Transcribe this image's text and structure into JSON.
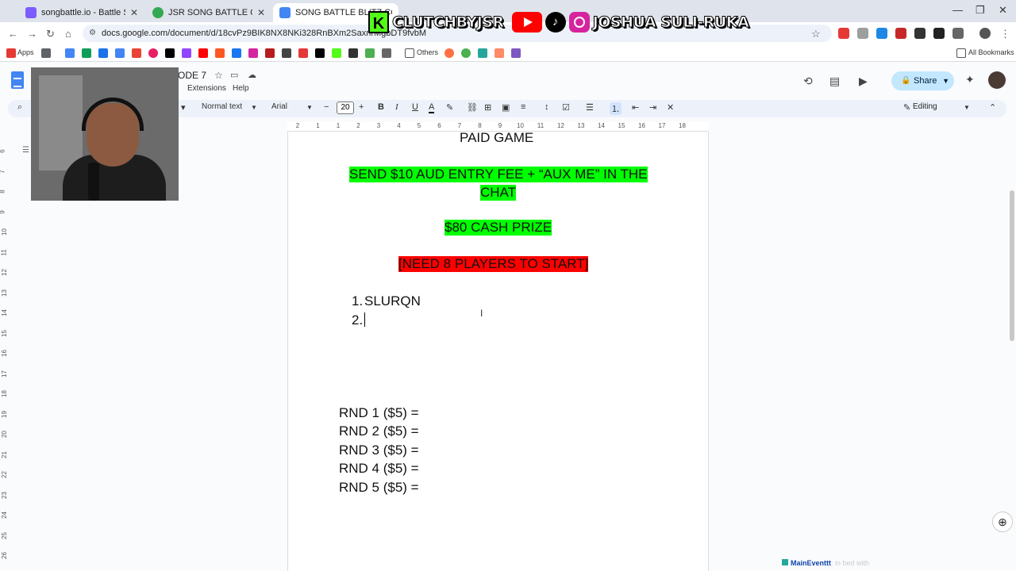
{
  "browser": {
    "tabs": [
      {
        "title": "songbattle.io - Battle Songs ag",
        "color": "#7c5cff"
      },
      {
        "title": "JSR SONG BATTLE CATEGORY",
        "color": "#34a853"
      },
      {
        "title": "SONG BATTLE BLITZ COMP",
        "color": "#4285f4"
      }
    ],
    "new_tab": "+",
    "url": "docs.google.com/document/d/18cvPz9BIK8NX8NKi328RnBXm2SaxnrMgbDT9fvbM",
    "window_controls": {
      "minimize": "—",
      "maximize": "❐",
      "close": "✕"
    }
  },
  "bookmarks": {
    "apps_label": "Apps",
    "others_label": "Others",
    "all_bookmarks_label": "All Bookmarks"
  },
  "overlay": {
    "kick_letter": "K",
    "kick_name": "CLUTCHBYJSR",
    "social_name": "JOSHUA SULI-RUKA"
  },
  "docs": {
    "title": "ODE 7",
    "menus": {
      "extensions": "Extensions",
      "help": "Help"
    },
    "share_label": "Share",
    "toolbar": {
      "style": "Normal text",
      "font": "Arial",
      "font_size": "20",
      "bold": "B",
      "italic": "I",
      "underline": "U",
      "text_color": "A",
      "mode": "Editing"
    },
    "ruler_numbers": [
      "2",
      "1",
      "1",
      "2",
      "3",
      "4",
      "5",
      "6",
      "7",
      "8",
      "9",
      "10",
      "11",
      "12",
      "13",
      "14",
      "15",
      "16",
      "17",
      "18"
    ],
    "vruler_numbers": [
      "6",
      "7",
      "8",
      "9",
      "10",
      "11",
      "12",
      "13",
      "14",
      "15",
      "16",
      "17",
      "18",
      "19",
      "20",
      "21",
      "22",
      "23",
      "24",
      "25",
      "26"
    ]
  },
  "document": {
    "heading": "PAID GAME",
    "entry_fee_line1": "SEND $10 AUD ENTRY FEE + “AUX ME” IN THE",
    "entry_fee_line2": "CHAT",
    "prize": "$80 CASH PRIZE",
    "players_needed": "[NEED 8 PLAYERS TO START]",
    "players": [
      {
        "num": "1.",
        "name": "SLURQN"
      },
      {
        "num": "2.",
        "name": ""
      }
    ],
    "rounds": [
      "RND 1 ($5) =",
      "RND 2 ($5) =",
      "RND 3 ($5) =",
      "RND 4 ($5) =",
      "RND 5 ($5) ="
    ],
    "highlight_green": "#00ff00",
    "highlight_red": "#ff0000"
  },
  "chat_overlay": {
    "user": "MainEventtt",
    "message": ": in bed with"
  }
}
